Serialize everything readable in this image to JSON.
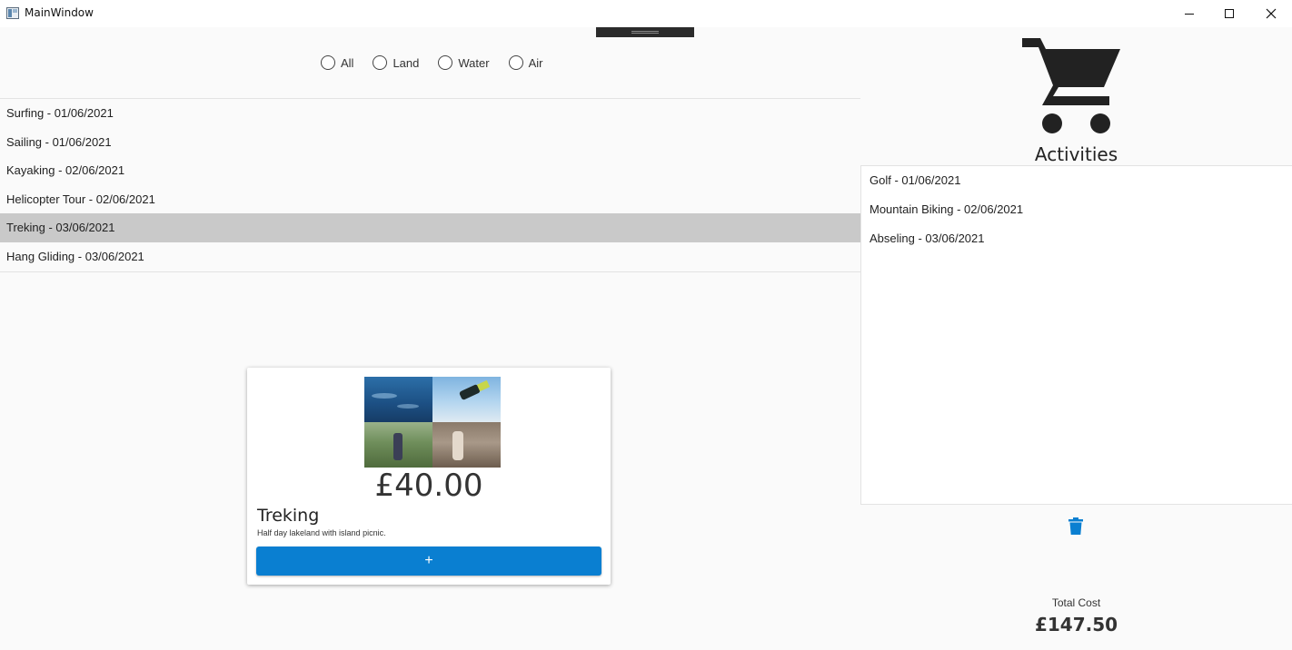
{
  "window": {
    "title": "MainWindow",
    "controls": [
      "minimize",
      "maximize",
      "close"
    ]
  },
  "filters": {
    "options": [
      {
        "label": "All",
        "selected": false
      },
      {
        "label": "Land",
        "selected": false
      },
      {
        "label": "Water",
        "selected": false
      },
      {
        "label": "Air",
        "selected": false
      }
    ]
  },
  "activities": {
    "items": [
      {
        "label": "Surfing - 01/06/2021",
        "selected": false
      },
      {
        "label": "Sailing - 01/06/2021",
        "selected": false
      },
      {
        "label": "Kayaking - 02/06/2021",
        "selected": false
      },
      {
        "label": "Helicopter Tour - 02/06/2021",
        "selected": false
      },
      {
        "label": "Treking - 03/06/2021",
        "selected": true
      },
      {
        "label": "Hang Gliding - 03/06/2021",
        "selected": false
      }
    ]
  },
  "detail": {
    "price": "£40.00",
    "title": "Treking",
    "description": "Half day lakeland with island picnic.",
    "add_label": "+"
  },
  "cart": {
    "icon": "shopping-cart-icon",
    "title": "Activities",
    "items": [
      {
        "label": "Golf - 01/06/2021"
      },
      {
        "label": "Mountain Biking - 02/06/2021"
      },
      {
        "label": "Abseling - 03/06/2021"
      }
    ],
    "delete_icon": "trash-icon",
    "total_label": "Total Cost",
    "total_value": "£147.50"
  },
  "colors": {
    "accent": "#0a7fd1",
    "selection": "#c9c9c9",
    "icon_dark": "#222222"
  }
}
